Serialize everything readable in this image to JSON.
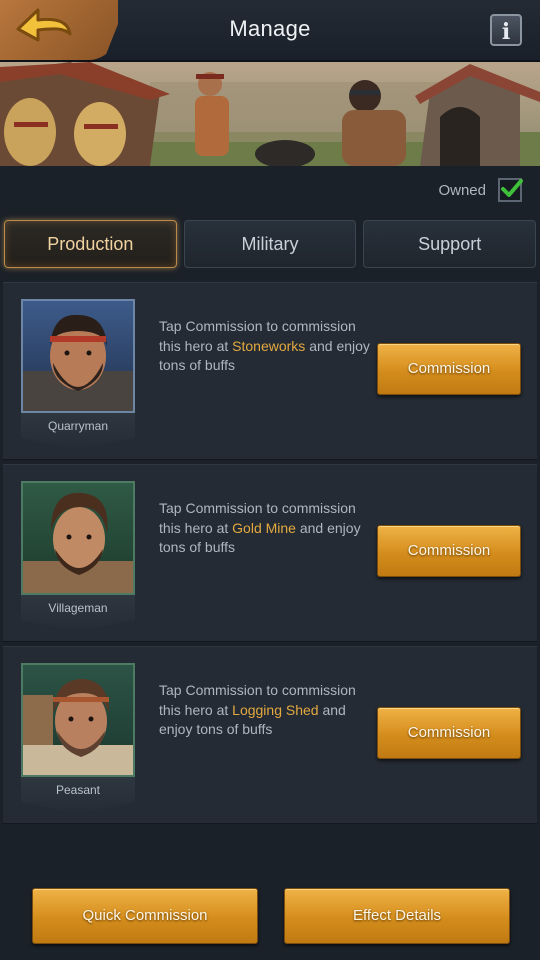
{
  "header": {
    "title": "Manage",
    "info_label": "i"
  },
  "owned": {
    "label": "Owned",
    "checked": true
  },
  "tabs": [
    {
      "label": "Production",
      "active": true
    },
    {
      "label": "Military",
      "active": false
    },
    {
      "label": "Support",
      "active": false
    }
  ],
  "heroes": [
    {
      "name": "Quarryman",
      "desc_pre": "Tap Commission to commission this hero at ",
      "location": "Stoneworks",
      "desc_post": " and enjoy tons of buffs",
      "button_label": "Commission"
    },
    {
      "name": "Villageman",
      "desc_pre": "Tap Commission to commission this hero at ",
      "location": "Gold Mine",
      "desc_post": " and enjoy tons of buffs",
      "button_label": "Commission"
    },
    {
      "name": "Peasant",
      "desc_pre": "Tap Commission to commission this hero at ",
      "location": "Logging Shed",
      "desc_post": " and enjoy tons of buffs",
      "button_label": "Commission"
    }
  ],
  "footer": {
    "quick_commission_label": "Quick Commission",
    "effect_details_label": "Effect Details"
  },
  "colors": {
    "accent_gold": "#e3a93f",
    "check_green": "#3fbf3a",
    "background": "#1b2129"
  }
}
